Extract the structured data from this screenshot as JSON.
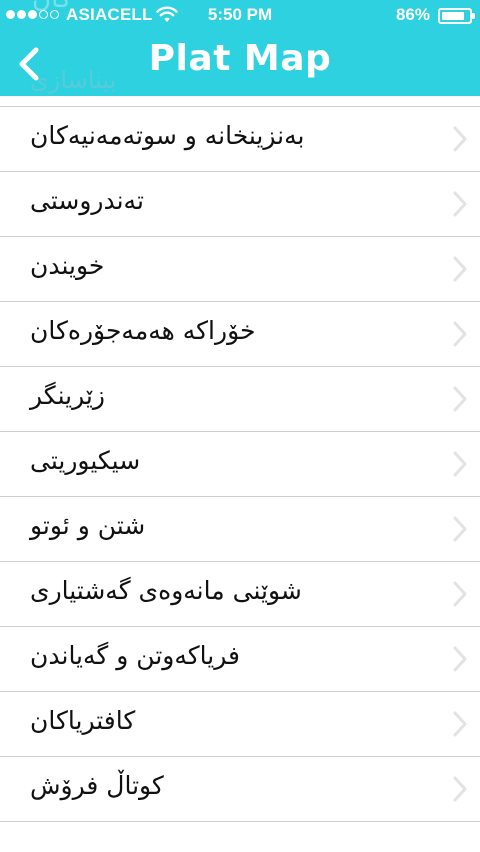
{
  "status_bar": {
    "signal_dots_filled": 3,
    "signal_dots_total": 5,
    "carrier": "ASIACELL",
    "wifi_icon": "wifi-icon",
    "time": "5:50 PM",
    "battery_percent_text": "86%",
    "battery_level": 0.86
  },
  "nav": {
    "back_icon": "chevron-left-icon",
    "title": "Plat Map",
    "bar_color": "#2ed1e0"
  },
  "list": {
    "chevron_icon": "chevron-right-icon",
    "items": [
      {
        "label": "بەنزینخانە و سوتەمەنیەکان"
      },
      {
        "label": "تەندروستی"
      },
      {
        "label": "خویندن"
      },
      {
        "label": "خۆراکە هەمەجۆرەکان"
      },
      {
        "label": "زێرینگر"
      },
      {
        "label": "سیکیوریتی"
      },
      {
        "label": "شتن و ئوتو"
      },
      {
        "label": "شوێنی مانەوەی گەشتیاری"
      },
      {
        "label": "فریاکەوتن و گەیاندن"
      },
      {
        "label": "کافتریاکان"
      },
      {
        "label": "کوتاڵ فرۆش"
      }
    ]
  },
  "ghost_text": {
    "top": "کان",
    "under_bar": "بیناسازی"
  }
}
